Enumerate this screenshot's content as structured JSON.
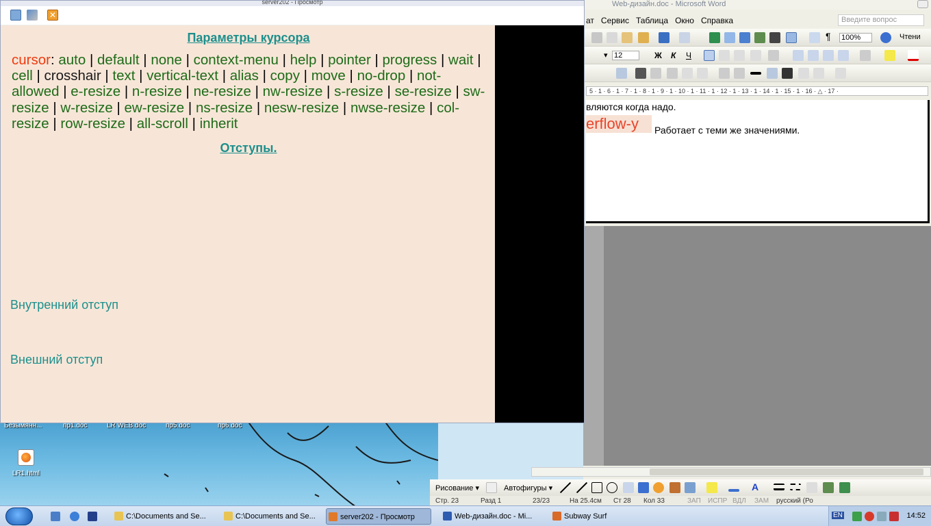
{
  "viewer": {
    "title": "server202 - Просмотр",
    "heading_cursor": "Параметры курсора",
    "cursor_keyword": "cursor",
    "cursor_colon": ":",
    "cursor_values": [
      "auto",
      "default",
      "none",
      "context-menu",
      "help",
      "pointer",
      "progress",
      "wait",
      "cell",
      "crosshair",
      "text",
      "vertical-text",
      "alias",
      "copy",
      "move",
      "no-drop",
      "not-allowed",
      "e-resize",
      "n-resize",
      "ne-resize",
      "nw-resize",
      "s-resize",
      "se-resize",
      "sw-resize",
      "w-resize",
      "ew-resize",
      "ns-resize",
      "nesw-resize",
      "nwse-resize",
      "col-resize",
      "row-resize",
      "all-scroll",
      "inherit"
    ],
    "heading_margins": "Отступы.",
    "inner_padding": "Внутренний отступ",
    "outer_margin": "Внешний отступ"
  },
  "word": {
    "title": "Web-дизайн.doc - Microsoft Word",
    "menu": [
      "ат",
      "Сервис",
      "Таблица",
      "Окно",
      "Справка"
    ],
    "help_placeholder": "Введите вопрос",
    "zoom": "100%",
    "reading_label": "Чтени",
    "font_size": "12",
    "bold": "Ж",
    "italic": "К",
    "underline": "Ч",
    "ruler": "5 · 1 · 6 · 1 · 7 · 1 · 8 · 1 · 9 · 1 · 10 · 1 · 11 · 1 · 12 · 1 · 13 · 1 · 14 · 1 · 15 · 1 · 16 · △ · 17 ·",
    "doc_line1": "вляются когда надо.",
    "doc_code": "erflow-y",
    "doc_line2": "Работает с теми же значениями.",
    "draw_label": "Рисование ▾",
    "autoshapes_label": "Автофигуры ▾",
    "status": {
      "page": "Стр. 23",
      "section": "Разд 1",
      "pages": "23/23",
      "pos": "На 25.4см",
      "line": "Ст 28",
      "col": "Кол 33",
      "rec": "ЗАП",
      "trk": "ИСПР",
      "ext": "ВДЛ",
      "ovr": "ЗАМ",
      "lang": "русский (Ро"
    }
  },
  "desktop": {
    "labels": [
      "Безымянн...",
      "пр1.doc",
      "LR WEB.doc",
      "пр5.doc",
      "пр6.doc"
    ],
    "file_icon_label": "LR1.html"
  },
  "taskbar": {
    "tasks": [
      "C:\\Documents and Se...",
      "C:\\Documents and Se...",
      "server202 - Просмотр",
      "Web-дизайн.doc - Mi...",
      "Subway Surf"
    ],
    "lang": "EN",
    "clock": "14:52"
  }
}
